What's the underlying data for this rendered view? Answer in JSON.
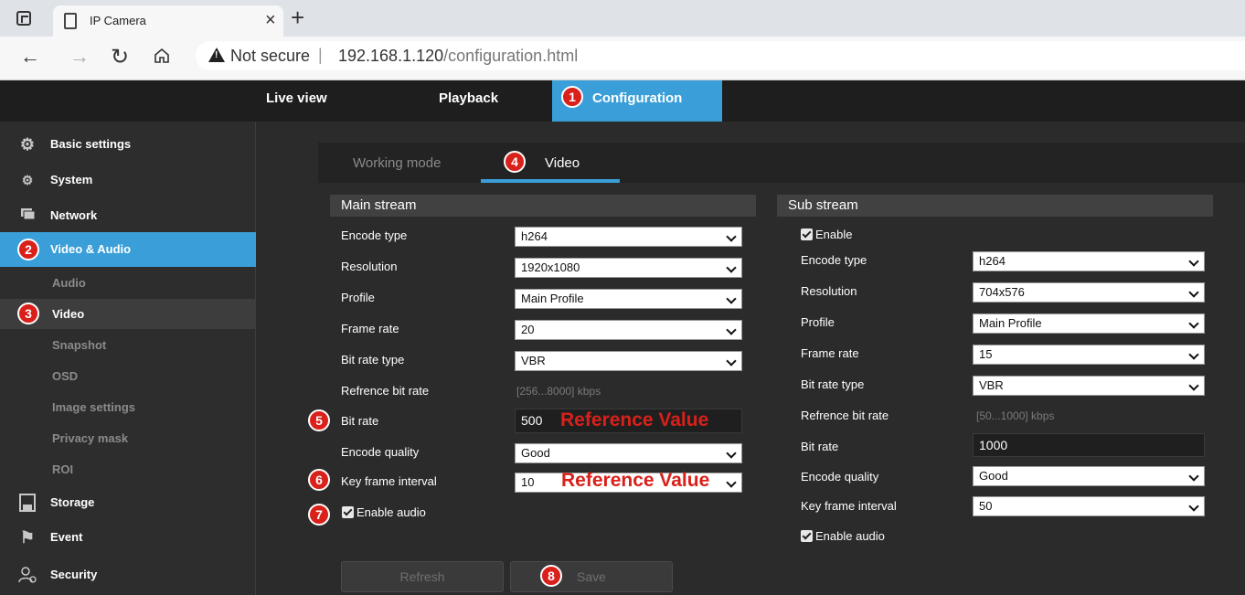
{
  "browser": {
    "tab_title": "IP Camera",
    "tab_close": "×",
    "new_tab": "+",
    "security_label": "Not secure",
    "separator": "|",
    "url_host": "192.168.1.120",
    "url_path": "/configuration.html"
  },
  "header": {
    "nav": [
      {
        "label": "Live view"
      },
      {
        "label": "Playback"
      },
      {
        "label": "Configuration",
        "badge": "1"
      }
    ]
  },
  "sidebar": {
    "items": [
      {
        "label": "Basic settings",
        "icon": "gear-icon"
      },
      {
        "label": "System",
        "icon": "gears-icon"
      },
      {
        "label": "Network",
        "icon": "network-icon"
      },
      {
        "label": "Video & Audio",
        "badge": "2"
      },
      {
        "label": "Storage",
        "icon": "storage-icon"
      },
      {
        "label": "Event",
        "icon": "event-icon"
      },
      {
        "label": "Security",
        "icon": "user-lock-icon"
      }
    ],
    "subitems": [
      {
        "label": "Audio"
      },
      {
        "label": "Video",
        "badge": "3"
      },
      {
        "label": "Snapshot"
      },
      {
        "label": "OSD"
      },
      {
        "label": "Image settings"
      },
      {
        "label": "Privacy mask"
      },
      {
        "label": "ROI"
      }
    ]
  },
  "tabs": {
    "working_mode": "Working mode",
    "video": "Video",
    "video_badge": "4"
  },
  "main_stream": {
    "title": "Main stream",
    "encode_type_label": "Encode type",
    "encode_type": "h264",
    "resolution_label": "Resolution",
    "resolution": "1920x1080",
    "profile_label": "Profile",
    "profile": "Main Profile",
    "frame_rate_label": "Frame rate",
    "frame_rate": "20",
    "bit_rate_type_label": "Bit rate type",
    "bit_rate_type": "VBR",
    "ref_bit_rate_label": "Refrence bit rate",
    "ref_bit_rate_hint": "[256...8000] kbps",
    "bit_rate_label": "Bit rate",
    "bit_rate": "500",
    "bit_rate_badge": "5",
    "encode_quality_label": "Encode quality",
    "encode_quality": "Good",
    "key_frame_label": "Key frame interval",
    "key_frame": "10",
    "key_frame_badge": "6",
    "enable_audio_label": "Enable audio",
    "enable_audio_badge": "7",
    "reference_value_note": "Reference Value"
  },
  "sub_stream": {
    "title": "Sub stream",
    "enable_label": "Enable",
    "encode_type_label": "Encode type",
    "encode_type": "h264",
    "resolution_label": "Resolution",
    "resolution": "704x576",
    "profile_label": "Profile",
    "profile": "Main Profile",
    "frame_rate_label": "Frame rate",
    "frame_rate": "15",
    "bit_rate_type_label": "Bit rate type",
    "bit_rate_type": "VBR",
    "ref_bit_rate_label": "Refrence bit rate",
    "ref_bit_rate_hint": "[50...1000] kbps",
    "bit_rate_label": "Bit rate",
    "bit_rate": "1000",
    "encode_quality_label": "Encode quality",
    "encode_quality": "Good",
    "key_frame_label": "Key frame interval",
    "key_frame": "50",
    "enable_audio_label": "Enable audio"
  },
  "buttons": {
    "refresh": "Refresh",
    "save": "Save",
    "save_badge": "8"
  }
}
